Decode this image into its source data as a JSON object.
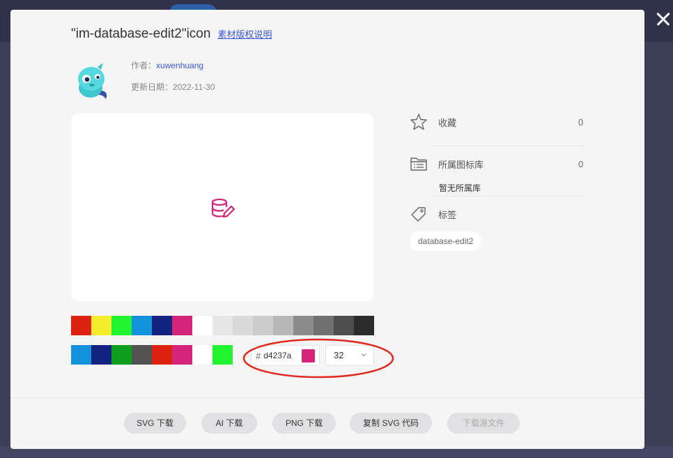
{
  "modal": {
    "title": "\"im-database-edit2\"icon",
    "license_link": "素材版权说明",
    "author_label": "作者：",
    "author_name": "xuwenhuang",
    "date_label": "更新日期：",
    "date_value": "2022-11-30"
  },
  "icon": {
    "name": "database-edit-icon",
    "color": "#d4237a"
  },
  "palette": {
    "row1": [
      "#dd2210",
      "#f5ec2e",
      "#22f530",
      "#1493dd",
      "#14237f",
      "#d4237a",
      "#ffffff",
      "#e6e6e6",
      "#d9d9d9",
      "#cccccc",
      "#b8b8b8",
      "#8c8c8c",
      "#707070",
      "#4d4d4d",
      "#2b2b2b"
    ],
    "row2": [
      "#1493dd",
      "#14237f",
      "#0f9e1c",
      "#525252",
      "#dd2210",
      "#d4237a",
      "#ffffff",
      "#22f530"
    ]
  },
  "color_field": {
    "hash": "#",
    "value": "d4237a"
  },
  "size_field": {
    "value": "32"
  },
  "sidebar": {
    "favorite_label": "收藏",
    "favorite_count": "0",
    "library_label": "所属图标库",
    "library_count": "0",
    "no_library_text": "暂无所属库",
    "tags_label": "标签",
    "tags": [
      "database-edit2"
    ]
  },
  "footer": {
    "svg_download": "SVG 下载",
    "ai_download": "AI 下载",
    "png_download": "PNG 下载",
    "copy_svg": "复制 SVG 代码",
    "download_source": "下载源文件"
  },
  "colors": {
    "accent_link": "#3a57d6",
    "annotation_red": "#e0281e"
  }
}
